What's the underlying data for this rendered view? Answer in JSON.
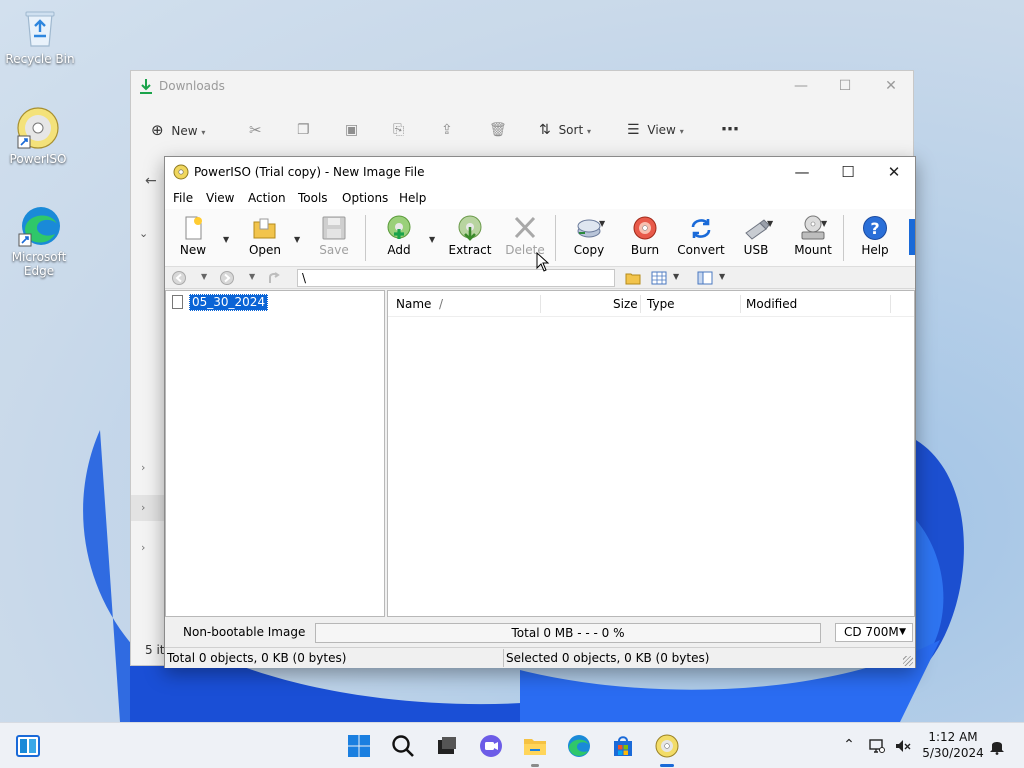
{
  "desktop": {
    "icons": [
      {
        "label": "Recycle Bin"
      },
      {
        "label": "PowerISO"
      },
      {
        "label": "Microsoft Edge"
      }
    ]
  },
  "explorer": {
    "title": "Downloads",
    "commands": {
      "new": "New",
      "sort": "Sort",
      "view": "View",
      "more": "⋯"
    },
    "items_count": "5 ite"
  },
  "poweriso": {
    "title": "PowerISO (Trial copy) - New Image File",
    "menu": [
      "File",
      "View",
      "Action",
      "Tools",
      "Options",
      "Help"
    ],
    "toolbar": {
      "new": "New",
      "open": "Open",
      "save": "Save",
      "add": "Add",
      "extract": "Extract",
      "delete": "Delete",
      "copy": "Copy",
      "burn": "Burn",
      "convert": "Convert",
      "usb": "USB",
      "mount": "Mount",
      "help": "Help"
    },
    "address_path": "\\",
    "tree": {
      "root": "05_30_2024"
    },
    "columns": {
      "name": "Name",
      "sort_indicator": "/",
      "size": "Size",
      "type": "Type",
      "modified": "Modified"
    },
    "status": {
      "boot": "Non-bootable Image",
      "total": "Total  0 MB   - - -  0 %",
      "media": "CD 700M",
      "total_objects": "Total 0 objects, 0 KB (0 bytes)",
      "selected_objects": "Selected 0 objects, 0 KB (0 bytes)"
    }
  },
  "taskbar": {
    "time": "1:12 AM",
    "date": "5/30/2024"
  },
  "colors": {
    "accent": "#0a64d6",
    "taskbar": "#eef1f6"
  }
}
